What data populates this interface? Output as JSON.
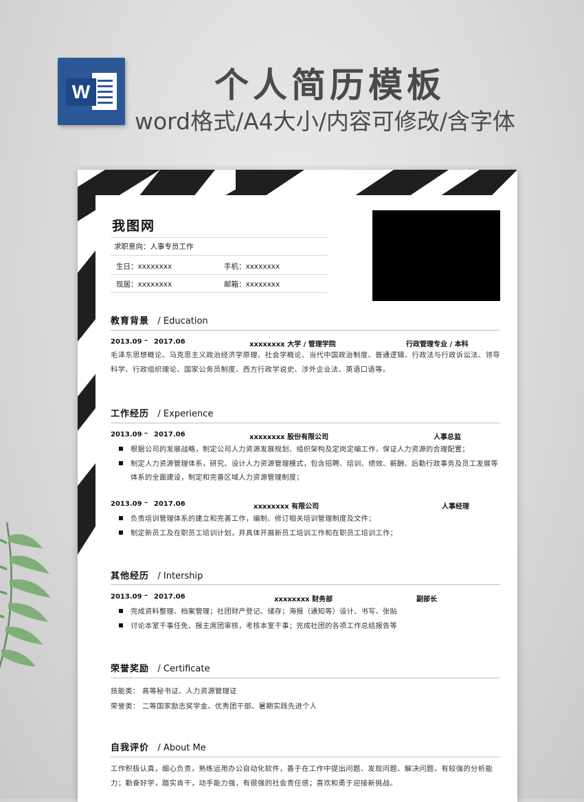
{
  "header": {
    "icon_letter": "W",
    "title": "个人简历模板",
    "subtitle": "word格式/A4大小/内容可修改/含字体"
  },
  "resume": {
    "name": "我图网",
    "objective": "求职意向：人事专员工作",
    "birth": "生日：xxxxxxxx",
    "phone": "手机：xxxxxxxx",
    "residence": "现居：xxxxxxxx",
    "email": "邮箱：xxxxxxxx",
    "education": {
      "title_cn": "教育背景",
      "title_en": "/ Education",
      "start": "2013.09",
      "dash": "–",
      "end": "2017.06",
      "school": "xxxxxxxx 大学 / 管理学院",
      "major": "行政管理专业 / 本科",
      "courses": "毛泽东思想概论、马克思主义政治经济学原理、社会学概论、当代中国政治制度、普通逻辑、行政法与行政诉讼法、领导科学、行政组织理论、国家公务员制度、西方行政学说史、涉外企业法、英语口语等。"
    },
    "experience": {
      "title_cn": "工作经历",
      "title_en": "/ Experience",
      "jobs": [
        {
          "start": "2013.09",
          "dash": "–",
          "end": "2017.06",
          "company": "xxxxxxxx 股份有限公司",
          "role": "人事总监",
          "bullets": [
            "根据公司的发展战略，制定公司人力资源发展规划、组织架构及定岗定编工作，保证人力资源的合理配置；",
            "制定人力资源管理体系，研究、设计人力资源管理模式，包含招聘、培训、绩效、薪酬、后勤行政事务及员工发展等体系的全面建设，制定和完善区域人力资源管理制度；"
          ]
        },
        {
          "start": "2013.09",
          "dash": "–",
          "end": "2017.06",
          "company": "xxxxxxxx 有限公司",
          "role": "人事经理",
          "bullets": [
            "负责培训管理体系的建立和完善工作，编制、修订相关培训管理制度及文件；",
            "制定新员工及在职员工培训计划，并具体开展新员工培训工作和在职员工培训工作；"
          ]
        }
      ]
    },
    "other": {
      "title_cn": "其他经历",
      "title_en": "/ Intership",
      "start": "2013.09",
      "dash": "–",
      "end": "2017.06",
      "org": "xxxxxxxx 财务部",
      "role": "副部长",
      "bullets": [
        "完成资料整理、档案管理；社团财产登记、储存；海报（通知等）设计、书写、张贴",
        "讨论本室干事任免、报主席团审核，考核本室干事；完成社团的各项工作总结报告等"
      ]
    },
    "awards": {
      "title_cn": "荣誉奖励",
      "title_en": "/ Certificate",
      "skills": "技能类： 高等秘书证、人力资源管理证",
      "honors": "荣誉类： 二等国家励志奖学金、优秀团干部、暑期实践先进个人"
    },
    "about": {
      "title_cn": "自我评价",
      "title_en": "/ About Me",
      "text": "工作积极认真，细心负责，熟练运用办公自动化软件，善于在工作中提出问题、发现问题、解决问题，有较强的分析能力；勤奋好学，踏实肯干，动手能力强，有很强的社会责任感；喜欢和勇于迎接新挑战。"
    }
  },
  "colors": {
    "word_blue": "#2b5797",
    "stripe": "#1f1f1f",
    "photo": "#000000"
  },
  "icons": {
    "word": "word-doc-icon",
    "leaf": "palm-leaf-icon"
  }
}
